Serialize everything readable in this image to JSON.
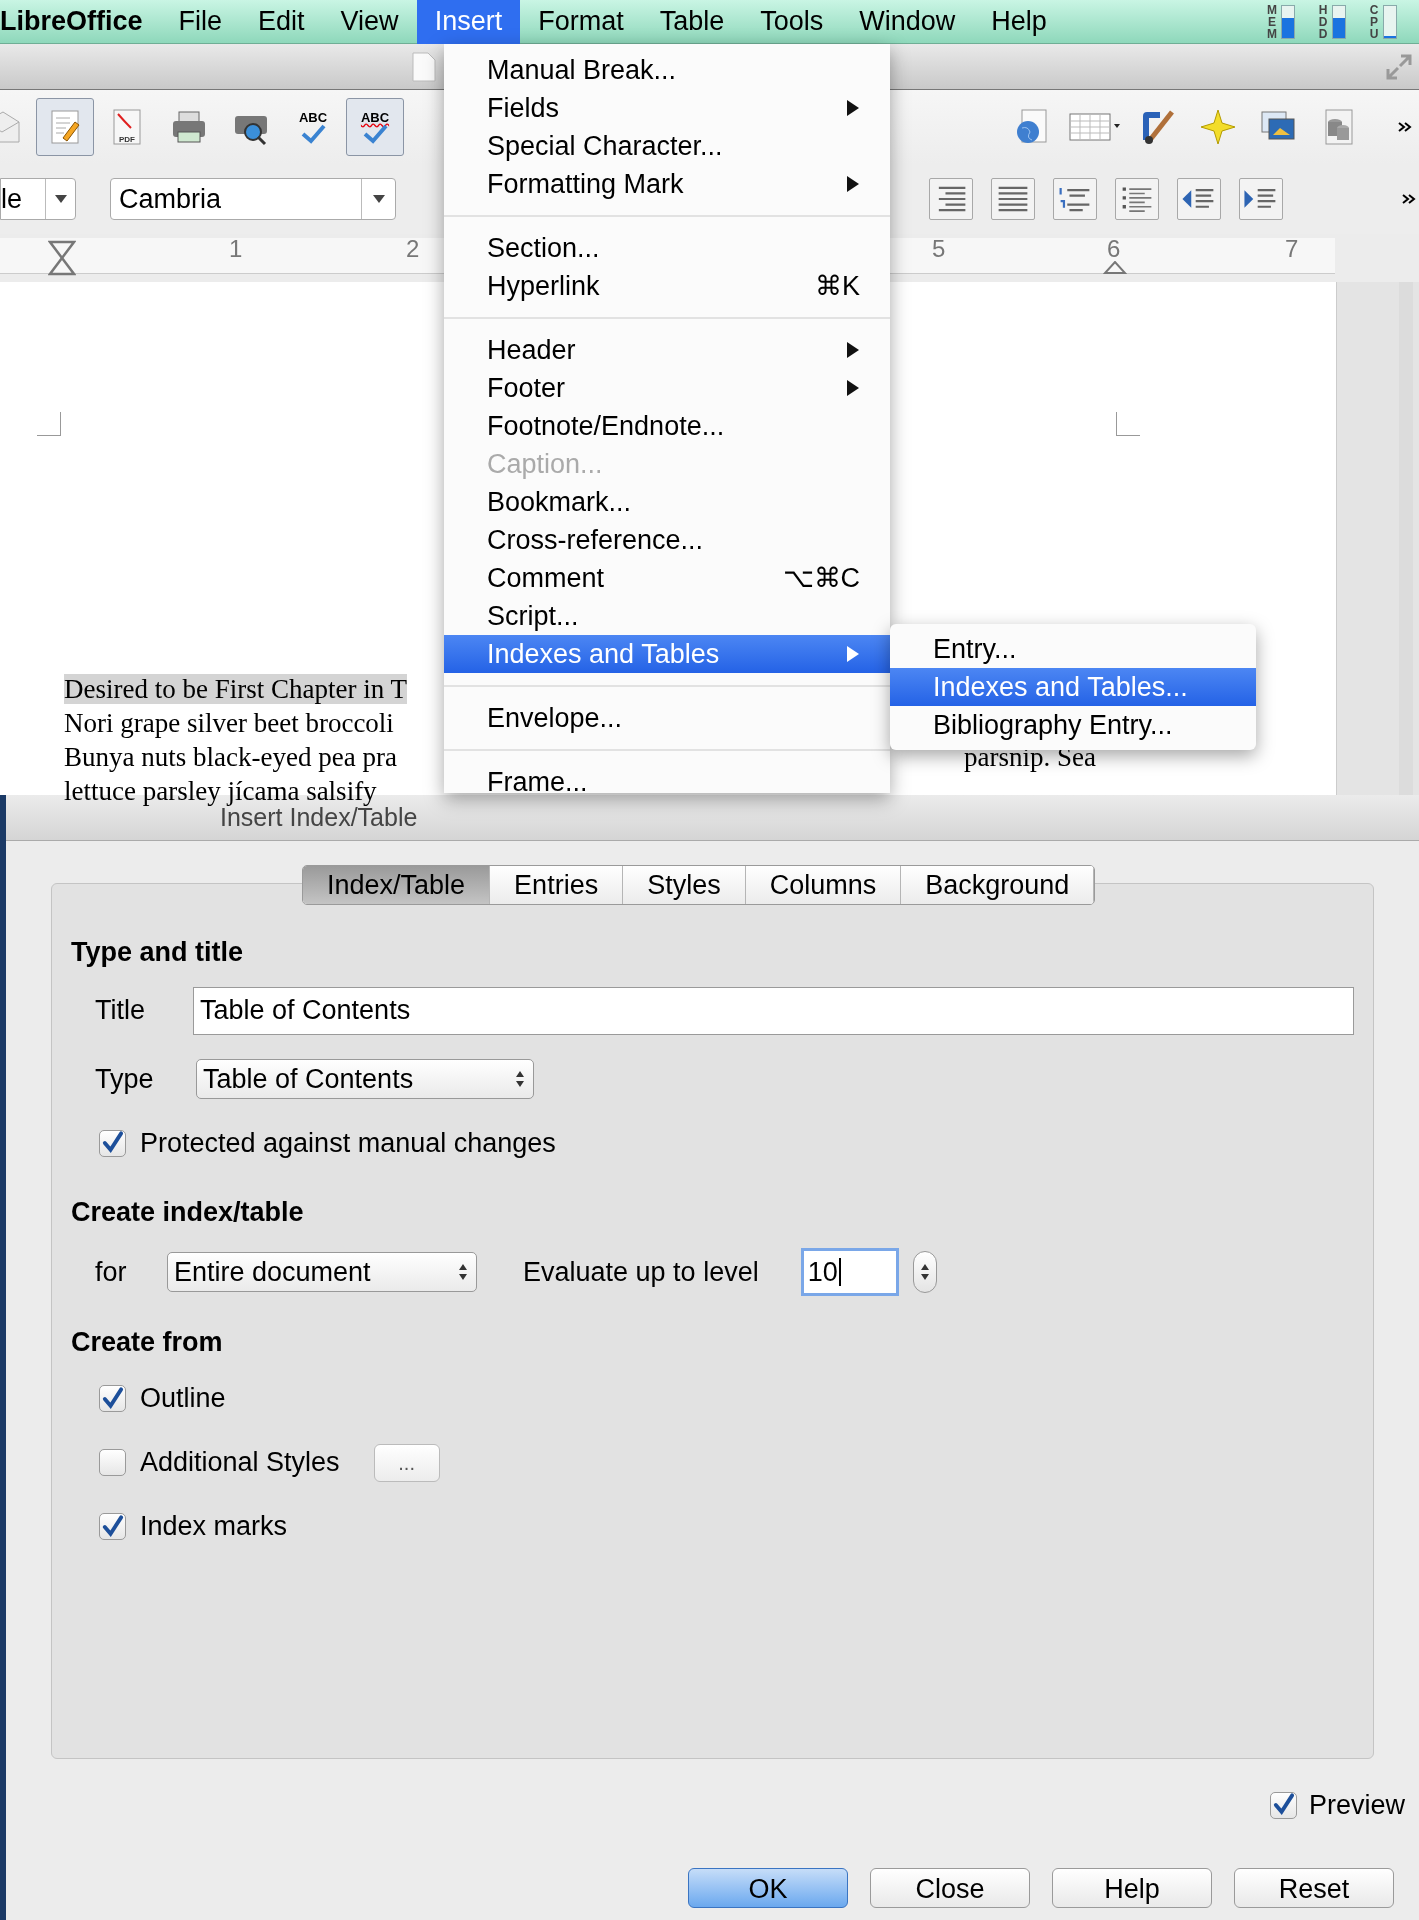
{
  "menubar": {
    "app": "LibreOffice",
    "items": [
      {
        "label": "File",
        "selected": false
      },
      {
        "label": "Edit",
        "selected": false
      },
      {
        "label": "View",
        "selected": false
      },
      {
        "label": "Insert",
        "selected": true
      },
      {
        "label": "Format",
        "selected": false
      },
      {
        "label": "Table",
        "selected": false
      },
      {
        "label": "Tools",
        "selected": false
      },
      {
        "label": "Window",
        "selected": false
      },
      {
        "label": "Help",
        "selected": false
      }
    ],
    "monitors": [
      {
        "label": "MEM",
        "level": 0.6
      },
      {
        "label": "HDD",
        "level": 0.6
      },
      {
        "label": "CPU",
        "level": 0.05
      }
    ]
  },
  "toolbar": {
    "row1_left": [
      {
        "kind": "mail",
        "pressed": false
      },
      {
        "kind": "edit",
        "pressed": true
      },
      {
        "kind": "pdf",
        "pressed": false,
        "label": "PDF"
      },
      {
        "kind": "print",
        "pressed": false
      },
      {
        "kind": "preview",
        "pressed": false
      },
      {
        "kind": "spell",
        "pressed": false,
        "label": "ABC"
      },
      {
        "kind": "autospell",
        "pressed": true,
        "label": "ABC"
      }
    ],
    "row1_right": [
      {
        "kind": "globe",
        "pressed": false
      },
      {
        "kind": "table",
        "pressed": false
      },
      {
        "kind": "brush",
        "pressed": false
      },
      {
        "kind": "star",
        "pressed": false
      },
      {
        "kind": "gallery",
        "pressed": false
      },
      {
        "kind": "database",
        "pressed": false
      }
    ],
    "style_field": "le",
    "font_field": "Cambria",
    "row2_right": [
      {
        "kind": "align-right"
      },
      {
        "kind": "justify"
      },
      {
        "kind": "numbered"
      },
      {
        "kind": "bullets"
      },
      {
        "kind": "outdent"
      },
      {
        "kind": "indent"
      }
    ]
  },
  "ruler": [
    "1",
    "2",
    "5",
    "6",
    "7"
  ],
  "document": {
    "lines": [
      {
        "text": "Desired to be First Chapter in T",
        "selected": true
      },
      {
        "text": "Nori grape silver beet broccoli",
        "selected": false
      },
      {
        "text": "Bunya nuts black-eyed pea pra",
        "selected": false
      },
      {
        "text": "lettuce parsley jícama salsify",
        "selected": false
      }
    ],
    "fragment": "parsnip. Sea"
  },
  "insert_menu": {
    "items": [
      {
        "kind": "item",
        "label": "Manual Break...",
        "submenu": false,
        "disabled": false,
        "selected": false
      },
      {
        "kind": "item",
        "label": "Fields",
        "submenu": true,
        "disabled": false,
        "selected": false
      },
      {
        "kind": "item",
        "label": "Special Character...",
        "submenu": false,
        "disabled": false,
        "selected": false
      },
      {
        "kind": "item",
        "label": "Formatting Mark",
        "submenu": true,
        "disabled": false,
        "selected": false
      },
      {
        "kind": "separator"
      },
      {
        "kind": "item",
        "label": "Section...",
        "submenu": false,
        "disabled": false,
        "selected": false
      },
      {
        "kind": "item",
        "label": "Hyperlink",
        "shortcut": "⌘K",
        "submenu": false,
        "disabled": false,
        "selected": false
      },
      {
        "kind": "separator"
      },
      {
        "kind": "item",
        "label": "Header",
        "submenu": true,
        "disabled": false,
        "selected": false
      },
      {
        "kind": "item",
        "label": "Footer",
        "submenu": true,
        "disabled": false,
        "selected": false
      },
      {
        "kind": "item",
        "label": "Footnote/Endnote...",
        "submenu": false,
        "disabled": false,
        "selected": false
      },
      {
        "kind": "item",
        "label": "Caption...",
        "submenu": false,
        "disabled": true,
        "selected": false
      },
      {
        "kind": "item",
        "label": "Bookmark...",
        "submenu": false,
        "disabled": false,
        "selected": false
      },
      {
        "kind": "item",
        "label": "Cross-reference...",
        "submenu": false,
        "disabled": false,
        "selected": false
      },
      {
        "kind": "item",
        "label": "Comment",
        "shortcut": "⌥⌘C",
        "submenu": false,
        "disabled": false,
        "selected": false
      },
      {
        "kind": "item",
        "label": "Script...",
        "submenu": false,
        "disabled": false,
        "selected": false
      },
      {
        "kind": "item",
        "label": "Indexes and Tables",
        "submenu": true,
        "disabled": false,
        "selected": true
      },
      {
        "kind": "separator"
      },
      {
        "kind": "item",
        "label": "Envelope...",
        "submenu": false,
        "disabled": false,
        "selected": false
      },
      {
        "kind": "separator"
      },
      {
        "kind": "item",
        "label": "Frame...",
        "submenu": false,
        "disabled": false,
        "selected": false
      }
    ]
  },
  "submenu": {
    "items": [
      {
        "label": "Entry...",
        "selected": false
      },
      {
        "label": "Indexes and Tables...",
        "selected": true
      },
      {
        "label": "Bibliography Entry...",
        "selected": false
      }
    ]
  },
  "dialog": {
    "title": "Insert Index/Table",
    "tabs": [
      {
        "label": "Index/Table",
        "selected": true
      },
      {
        "label": "Entries",
        "selected": false
      },
      {
        "label": "Styles",
        "selected": false
      },
      {
        "label": "Columns",
        "selected": false
      },
      {
        "label": "Background",
        "selected": false
      }
    ],
    "type_and_title": {
      "heading": "Type and title",
      "title_label": "Title",
      "title_value": "Table of Contents",
      "type_label": "Type",
      "type_value": "Table of Contents",
      "protected": {
        "label": "Protected against manual changes",
        "checked": true
      }
    },
    "create_index": {
      "heading": "Create index/table",
      "for_label": "for",
      "for_value": "Entire document",
      "level_label": "Evaluate up to level",
      "level_value": "10"
    },
    "create_from": {
      "heading": "Create from",
      "options": [
        {
          "label": "Outline",
          "checked": true
        },
        {
          "label": "Additional Styles",
          "checked": false,
          "button": "..."
        },
        {
          "label": "Index marks",
          "checked": true
        }
      ]
    },
    "preview": {
      "label": "Preview",
      "checked": true
    },
    "buttons": [
      {
        "label": "OK",
        "default": true
      },
      {
        "label": "Close",
        "default": false
      },
      {
        "label": "Help",
        "default": false
      },
      {
        "label": "Reset",
        "default": false
      }
    ]
  }
}
